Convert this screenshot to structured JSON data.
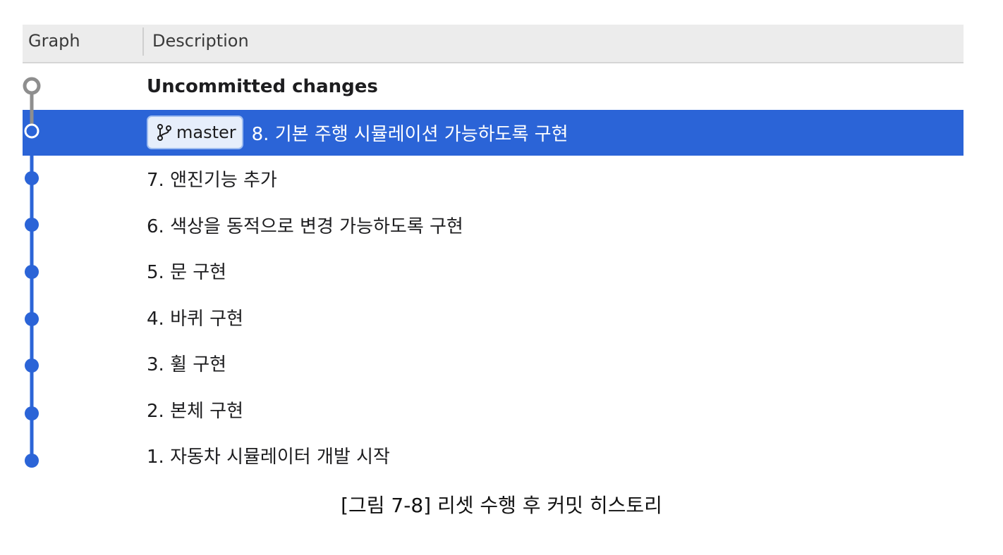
{
  "table": {
    "columns": {
      "graph": "Graph",
      "description": "Description"
    },
    "rows": [
      {
        "description": "Uncommitted changes"
      },
      {
        "branch": "master",
        "description": "8. 기본 주행 시뮬레이션 가능하도록 구현"
      },
      {
        "description": "7. 앤진기능 추가"
      },
      {
        "description": "6. 색상을 동적으로 변경 가능하도록 구현"
      },
      {
        "description": "5. 문 구현"
      },
      {
        "description": "4. 바퀴 구현"
      },
      {
        "description": "3. 휠 구현"
      },
      {
        "description": "2. 본체 구현"
      },
      {
        "description": "1. 자동차 시뮬레이터 개발 시작"
      }
    ]
  },
  "caption": "[그림 7-8] 리셋 수행 후 커밋 히스토리",
  "colors": {
    "accent": "#2b64d7",
    "graph_line": "#2b64d7",
    "uncommitted_node": "#8e8e8e",
    "header_bg": "#ececec"
  },
  "icons": {
    "branch": "git-branch-icon"
  }
}
